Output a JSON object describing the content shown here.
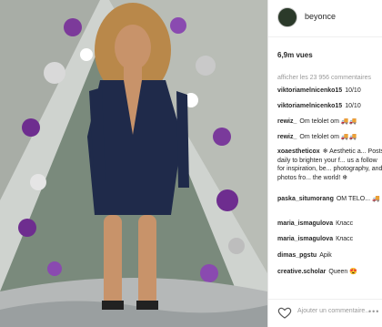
{
  "post": {
    "username": "beyonce",
    "views": "6,9m vues",
    "show_all": "afficher les 23 956 commentaires",
    "comments": [
      {
        "user": "viktoriamelnicenko15",
        "text": "10/10"
      },
      {
        "user": "viktoriamelnicenko15",
        "text": "10/10"
      },
      {
        "user": "rewiz_",
        "text": "Om telolet om 🚚🚚"
      },
      {
        "user": "rewiz_",
        "text": "Om telolet om 🚚🚚"
      },
      {
        "user": "xoaestheticox",
        "text": "❄ Aesthetic a... Posts daily to brighten your f... us a follow for inspiration, be... photography, and photos fro... the world! ❄"
      },
      {
        "user": "paska_situmorang",
        "text": "OM TELO... 🚚"
      },
      {
        "user": "maria_ismagulova",
        "text": "Класс"
      },
      {
        "user": "maria_ismagulova",
        "text": "Класс"
      },
      {
        "user": "dimas_pgstu",
        "text": "Apik"
      },
      {
        "user": "creative.scholar",
        "text": "Queen 😍"
      }
    ],
    "add_comment_placeholder": "Ajouter un commentaire...",
    "more_icon": "more-options-icon",
    "like_icon": "heart-icon"
  }
}
